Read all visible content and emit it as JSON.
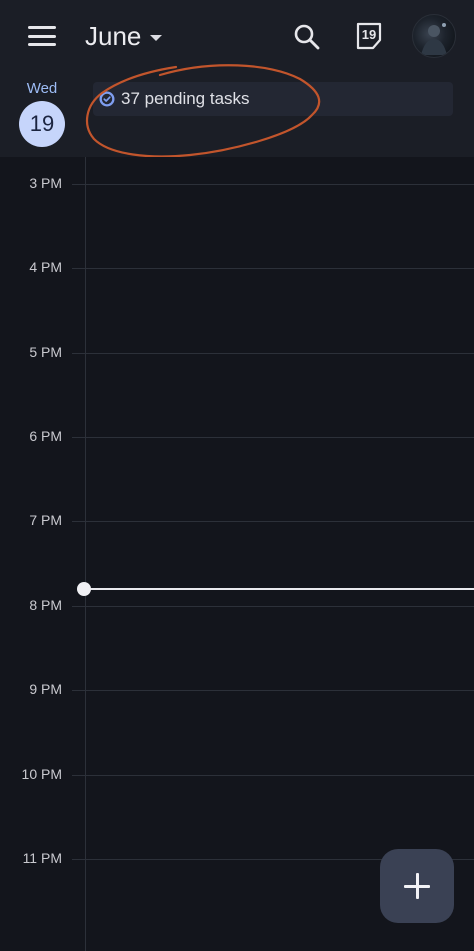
{
  "header": {
    "month": "June",
    "today_number": "19",
    "menu_icon": "hamburger-menu-icon",
    "search_icon": "search-icon",
    "today_icon": "calendar-today-icon",
    "avatar_icon": "profile-avatar"
  },
  "day": {
    "weekday": "Wed",
    "date": "19"
  },
  "tasks": {
    "label": "37 pending tasks",
    "icon": "task-check-icon"
  },
  "timeline": {
    "hours": [
      "3 PM",
      "4 PM",
      "5 PM",
      "6 PM",
      "7 PM",
      "8 PM",
      "9 PM",
      "10 PM",
      "11 PM"
    ]
  },
  "fab": {
    "icon": "plus-icon"
  },
  "colors": {
    "background": "#13151c",
    "header_bg": "#1b1e26",
    "accent": "#c6d5fb",
    "annotation": "#c2552c"
  }
}
